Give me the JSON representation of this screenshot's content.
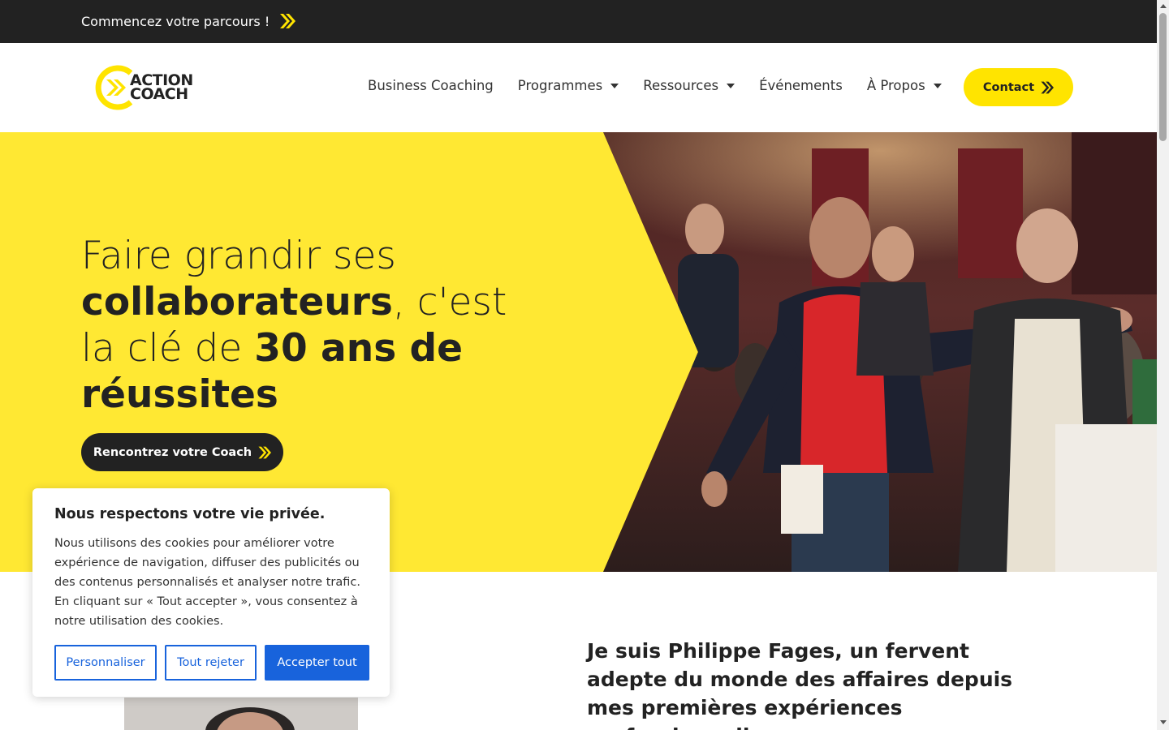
{
  "topbar": {
    "link_label": "Commencez votre parcours !"
  },
  "header": {
    "logo_text_line1": "ACTION",
    "logo_text_line2": "COACH",
    "nav": [
      {
        "label": "Business Coaching",
        "has_dropdown": false
      },
      {
        "label": "Programmes",
        "has_dropdown": true
      },
      {
        "label": "Ressources",
        "has_dropdown": true
      },
      {
        "label": "Événements",
        "has_dropdown": false
      },
      {
        "label": "À Propos",
        "has_dropdown": true
      }
    ],
    "contact_label": "Contact"
  },
  "hero": {
    "title_part1": "Faire grandir ses ",
    "title_bold1": "collaborateurs",
    "title_part2": ", c'est la clé de ",
    "title_bold2": "30 ans de réussites",
    "cta_label": "Rencontrez votre Coach"
  },
  "intro": {
    "text": "Je suis Philippe Fages, un fervent adepte du monde des affaires depuis mes premières expériences professionnelles."
  },
  "cookie": {
    "title": "Nous respectons votre vie privée.",
    "body": "Nous utilisons des cookies pour améliorer votre expérience de navigation, diffuser des publicités ou des contenus personnalisés et analyser notre trafic. En cliquant sur « Tout accepter », vous consentez à notre utilisation des cookies.",
    "customize_label": "Personnaliser",
    "reject_label": "Tout rejeter",
    "accept_label": "Accepter tout"
  },
  "colors": {
    "brand_yellow": "#ffe400",
    "dark": "#222222",
    "cookie_blue": "#1863dc"
  }
}
